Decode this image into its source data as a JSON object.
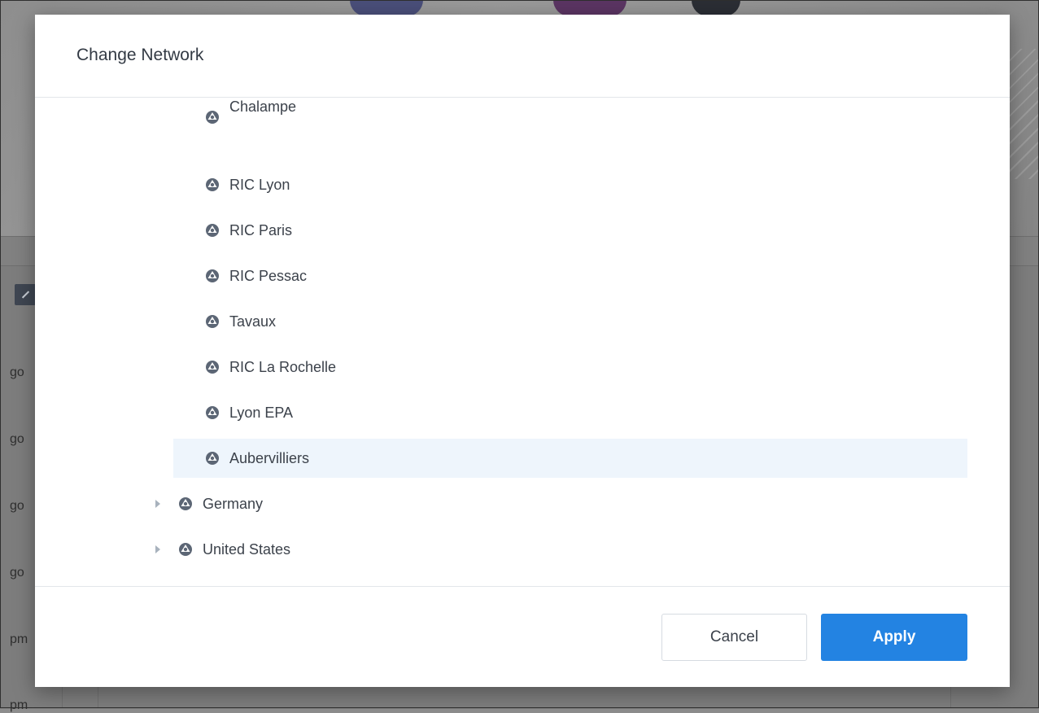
{
  "background": {
    "row_fragments": [
      "go",
      "go",
      "go",
      "go",
      "pm",
      "pm"
    ]
  },
  "dialog": {
    "title": "Change Network",
    "tree": {
      "children": [
        {
          "label": "Chalampe",
          "icon": "network-node-icon"
        },
        {
          "label": "RIC Lyon",
          "icon": "network-node-icon"
        },
        {
          "label": "RIC Paris",
          "icon": "network-node-icon"
        },
        {
          "label": "RIC Pessac",
          "icon": "network-node-icon"
        },
        {
          "label": "Tavaux",
          "icon": "network-node-icon"
        },
        {
          "label": "RIC La Rochelle",
          "icon": "network-node-icon"
        },
        {
          "label": "Lyon EPA",
          "icon": "network-node-icon"
        },
        {
          "label": "Aubervilliers",
          "icon": "network-node-icon",
          "selected": true
        }
      ],
      "top_level": [
        {
          "label": "Germany",
          "icon": "network-node-icon",
          "expander": "caret-right-icon"
        },
        {
          "label": "United States",
          "icon": "network-node-icon",
          "expander": "caret-right-icon"
        }
      ]
    },
    "buttons": {
      "cancel_label": "Cancel",
      "apply_label": "Apply"
    }
  },
  "colors": {
    "accent": "#2383e2",
    "selected_row": "#eef5fc",
    "icon": "#5c6675",
    "overlay": "#7f7f7f"
  }
}
